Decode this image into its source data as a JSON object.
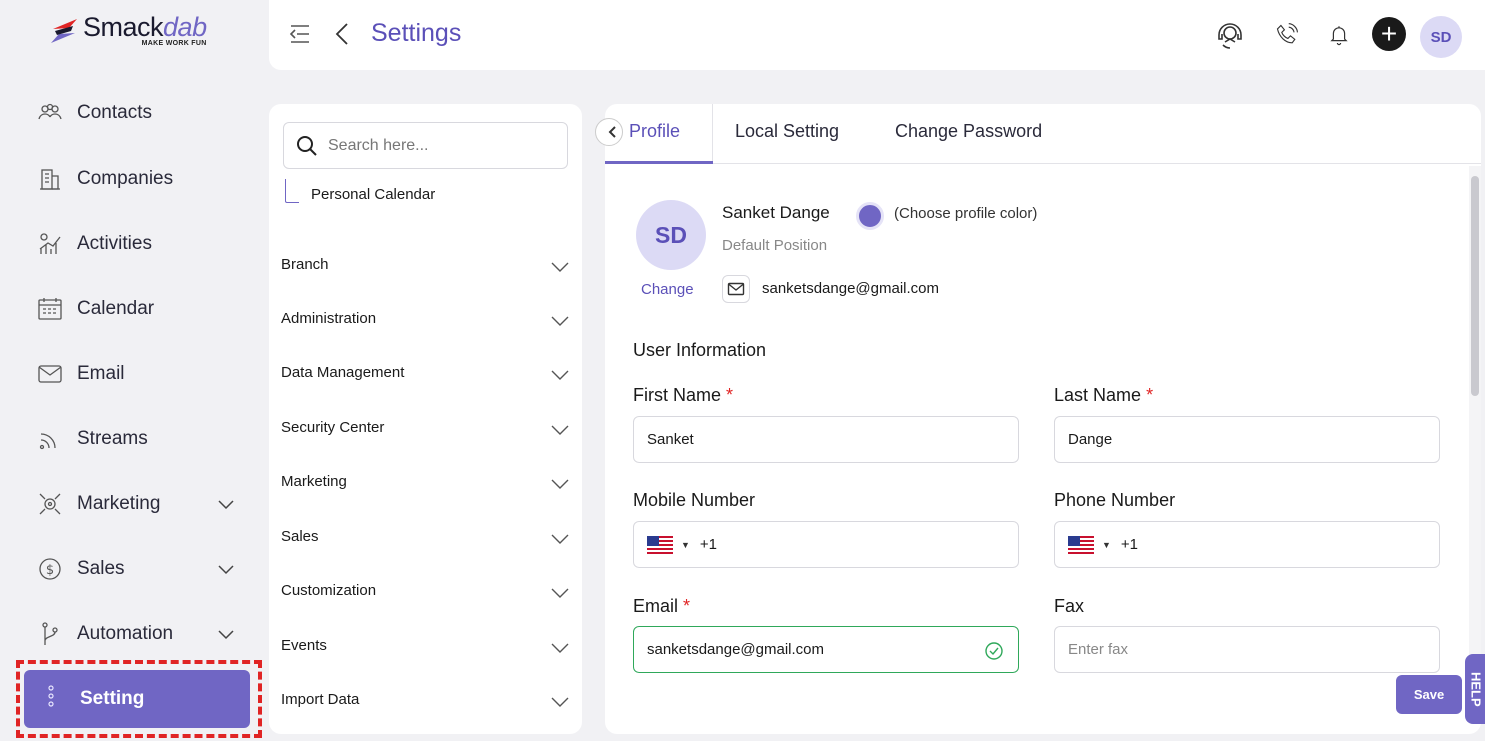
{
  "brand": {
    "name_main": "Smack",
    "name_italic": "dab",
    "tagline": "MAKE WORK FUN"
  },
  "sidebar": {
    "items": [
      {
        "label": "Contacts",
        "icon": "contacts-icon"
      },
      {
        "label": "Companies",
        "icon": "companies-icon"
      },
      {
        "label": "Activities",
        "icon": "activities-icon"
      },
      {
        "label": "Calendar",
        "icon": "calendar-icon"
      },
      {
        "label": "Email",
        "icon": "email-icon"
      },
      {
        "label": "Streams",
        "icon": "streams-icon"
      },
      {
        "label": "Marketing",
        "icon": "marketing-icon",
        "expandable": true
      },
      {
        "label": "Sales",
        "icon": "sales-icon",
        "expandable": true
      },
      {
        "label": "Automation",
        "icon": "automation-icon",
        "expandable": true
      }
    ],
    "active": {
      "label": "Setting",
      "icon": "more-vertical-icon"
    }
  },
  "header": {
    "title": "Settings",
    "avatar_initials": "SD",
    "plus_label": "+"
  },
  "settings_menu": {
    "search_placeholder": "Search here...",
    "sub_item": "Personal Calendar",
    "sections": [
      "Branch",
      "Administration",
      "Data Management",
      "Security Center",
      "Marketing",
      "Sales",
      "Customization",
      "Events",
      "Import Data"
    ]
  },
  "profile": {
    "tabs": [
      "Profile",
      "Local Setting",
      "Change Password"
    ],
    "active_tab": "Profile",
    "avatar_initials": "SD",
    "change_label": "Change",
    "name": "Sanket Dange",
    "choose_color_label": "(Choose profile color)",
    "position": "Default Position",
    "email": "sanketsdange@gmail.com",
    "profile_color": "#7066c4",
    "section_title": "User Information",
    "fields": {
      "first_name": {
        "label": "First Name",
        "value": "Sanket",
        "required": "*"
      },
      "last_name": {
        "label": "Last Name",
        "value": "Dange",
        "required": "*"
      },
      "mobile": {
        "label": "Mobile Number",
        "value": "+1"
      },
      "phone": {
        "label": "Phone Number",
        "value": "+1"
      },
      "email": {
        "label": "Email",
        "value": "sanketsdange@gmail.com",
        "required": "*"
      },
      "fax": {
        "label": "Fax",
        "value": "",
        "placeholder": "Enter fax"
      }
    },
    "save_label": "Save",
    "help_label": "HELP"
  },
  "colors": {
    "accent": "#7066c4",
    "accent_text": "#5b50b8",
    "required": "#e02424",
    "valid": "#2fa85a"
  }
}
